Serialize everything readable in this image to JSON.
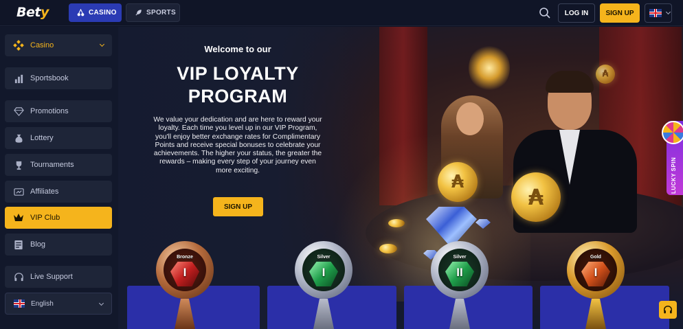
{
  "header": {
    "logo_main": "Bet",
    "logo_accent": "y",
    "tabs": [
      {
        "label": "CASINO",
        "icon": "cherry-icon"
      },
      {
        "label": "SPORTS",
        "icon": "rocket-icon"
      }
    ],
    "login_label": "LOG IN",
    "signup_label": "SIGN UP",
    "language_flag": "uk-flag-icon"
  },
  "sidebar": {
    "items": [
      {
        "label": "Casino",
        "icon": "casino-icon"
      },
      {
        "label": "Sportsbook",
        "icon": "sportsbook-icon"
      },
      {
        "label": "Promotions",
        "icon": "diamond-icon"
      },
      {
        "label": "Lottery",
        "icon": "money-bag-icon"
      },
      {
        "label": "Tournaments",
        "icon": "trophy-icon"
      },
      {
        "label": "Affiliates",
        "icon": "affiliates-icon"
      },
      {
        "label": "VIP Club",
        "icon": "crown-icon"
      },
      {
        "label": "Blog",
        "icon": "blog-icon"
      },
      {
        "label": "Live Support",
        "icon": "headset-icon"
      }
    ],
    "language": "English"
  },
  "hero": {
    "welcome": "Welcome to our",
    "title_line1": "VIP LOYALTY",
    "title_line2": "PROGRAM",
    "description": "We value your dedication and are here to reward your loyalty. Each time you level up in our VIP Program, you'll enjoy better exchange rates for Complimentary Points and receive special bonuses to celebrate your achievements. The higher your status, the greater the rewards – making every step of your journey even more exciting.",
    "signup_label": "SIGN UP"
  },
  "levels": [
    {
      "tier": "Bronze",
      "numeral": "I"
    },
    {
      "tier": "Silver",
      "numeral": "I"
    },
    {
      "tier": "Silver",
      "numeral": "II"
    },
    {
      "tier": "Gold",
      "numeral": "I"
    }
  ],
  "lucky_spin": {
    "label": "LUCKY SPIN"
  },
  "colors": {
    "accent": "#f5b41c",
    "casino_tab": "#2b3bb4",
    "background": "#0f1426",
    "card": "#2b2fa8"
  }
}
